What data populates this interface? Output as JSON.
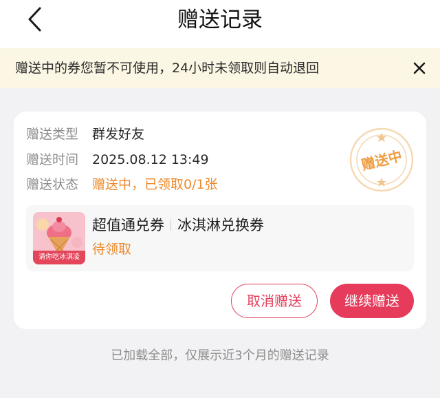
{
  "header": {
    "title": "赠送记录",
    "back_icon": "chevron-left-icon"
  },
  "notice": {
    "text": "赠送中的券您暂不可使用，24小时未领取则自动退回",
    "close_icon": "close-icon",
    "background": "#fcf7e4"
  },
  "record": {
    "type_label": "赠送类型",
    "type_value": "群发好友",
    "time_label": "赠送时间",
    "time_value": "2025.08.12 13:49",
    "status_label": "赠送状态",
    "status_value": "赠送中，已领取0/1张",
    "stamp_text": "赠送中",
    "coupon": {
      "name": "超值通兑券",
      "subname": "冰淇淋兑换券",
      "status": "待领取",
      "thumb_label": "请你吃冰淇凌"
    },
    "cancel_label": "取消赠送",
    "continue_label": "继续赠送"
  },
  "footer": {
    "note": "已加载全部，仅展示近3个月的赠送记录"
  },
  "colors": {
    "accent": "#e63b5a",
    "orange": "#ec8a2c",
    "page_bg": "#f2f2f4"
  }
}
